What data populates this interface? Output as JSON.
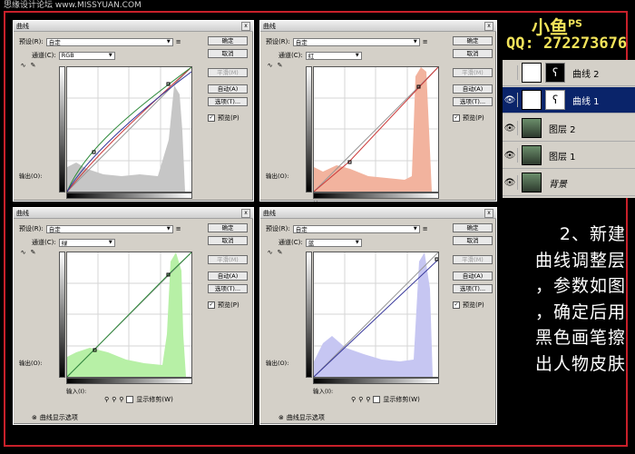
{
  "watermark": "思缘设计论坛 www.MISSYUAN.COM",
  "brand": {
    "name": "小鱼",
    "suffix": "PS",
    "qq": "QQ: 272273676"
  },
  "layers": [
    {
      "name": "曲线 2",
      "visible": false,
      "selected": false,
      "type": "adjustment"
    },
    {
      "name": "曲线 1",
      "visible": true,
      "selected": true,
      "type": "adjustment"
    },
    {
      "name": "图层 2",
      "visible": true,
      "selected": false,
      "type": "pixel"
    },
    {
      "name": "图层 1",
      "visible": true,
      "selected": false,
      "type": "pixel"
    },
    {
      "name": "背景",
      "visible": true,
      "selected": false,
      "type": "pixel"
    }
  ],
  "description": {
    "line1": "2、新建",
    "line2": "曲线调整层",
    "line3": "，参数如图",
    "line4": "，确定后用",
    "line5": "黑色画笔擦",
    "line6": "出人物皮肤"
  },
  "common": {
    "title": "曲线",
    "preset_label": "预设(R):",
    "preset_value": "自定",
    "channel_label": "通道(C):",
    "ok": "确定",
    "cancel": "取消",
    "smooth": "平滑(M)",
    "auto": "自动(A)",
    "options": "选项(T)...",
    "preview": "预览(P)",
    "output": "输出(O):",
    "input": "输入(I):",
    "clipping": "显示修剪(W)",
    "curve_options": "曲线显示选项",
    "close": "x"
  },
  "dialogs": [
    {
      "channel": "RGB",
      "color": "#b9b9b9"
    },
    {
      "channel": "红",
      "color": "#f2b39e"
    },
    {
      "channel": "绿",
      "color": "#b7f0a6"
    },
    {
      "channel": "蓝",
      "color": "#c6c6f2"
    }
  ]
}
